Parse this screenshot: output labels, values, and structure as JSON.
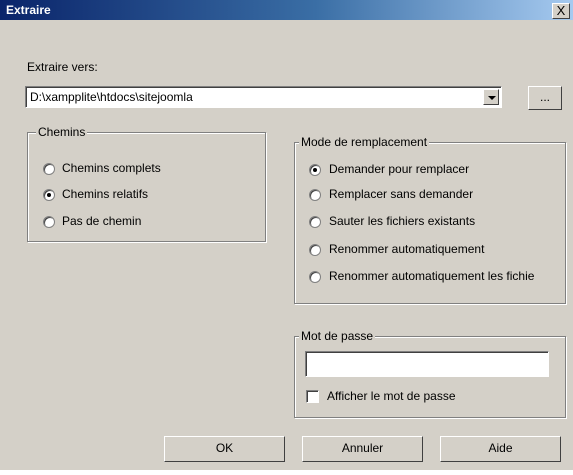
{
  "window": {
    "title": "Extraire",
    "close_symbol": "X"
  },
  "extract": {
    "label": "Extraire vers:",
    "path_value": "D:\\xampplite\\htdocs\\sitejoomla",
    "browse_label": "..."
  },
  "paths_group": {
    "title": "Chemins",
    "options": [
      "Chemins complets",
      "Chemins relatifs",
      "Pas de chemin"
    ],
    "selected_index": 1
  },
  "overwrite_group": {
    "title": "Mode de remplacement",
    "options": [
      "Demander pour remplacer",
      "Remplacer sans demander",
      "Sauter les fichiers existants",
      "Renommer automatiquement",
      "Renommer automatiquement les fichie"
    ],
    "selected_index": 0
  },
  "password_group": {
    "title": "Mot de passe",
    "value": "",
    "show_label": "Afficher le mot de passe",
    "show_checked": false
  },
  "buttons": {
    "ok": "OK",
    "cancel": "Annuler",
    "help": "Aide"
  },
  "colors": {
    "face": "#d4d0c8",
    "title_start": "#0a246a",
    "title_end": "#a6caf0"
  }
}
